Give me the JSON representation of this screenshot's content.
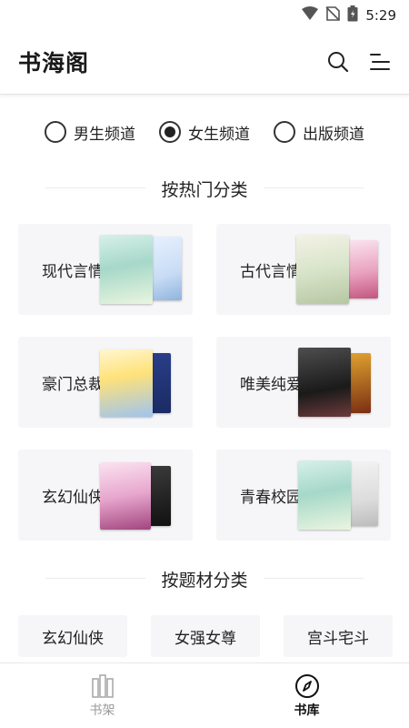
{
  "status_bar": {
    "time": "5:29"
  },
  "header": {
    "title": "书海阁"
  },
  "channels": [
    {
      "label": "男生频道",
      "selected": false
    },
    {
      "label": "女生频道",
      "selected": true
    },
    {
      "label": "出版频道",
      "selected": false
    }
  ],
  "sections": {
    "popular": "按热门分类",
    "theme": "按题材分类"
  },
  "categories": [
    {
      "label": "现代言情"
    },
    {
      "label": "古代言情"
    },
    {
      "label": "豪门总裁"
    },
    {
      "label": "唯美纯爱"
    },
    {
      "label": "玄幻仙侠"
    },
    {
      "label": "青春校园"
    }
  ],
  "theme_tags": [
    "玄幻仙侠",
    "女强女尊",
    "宫斗宅斗"
  ],
  "tab_bar": {
    "shelf": "书架",
    "library": "书库",
    "active": "library"
  },
  "colors": {
    "accent": "#111111",
    "card_bg": "#f6f6f8",
    "inactive_text": "#999999"
  }
}
